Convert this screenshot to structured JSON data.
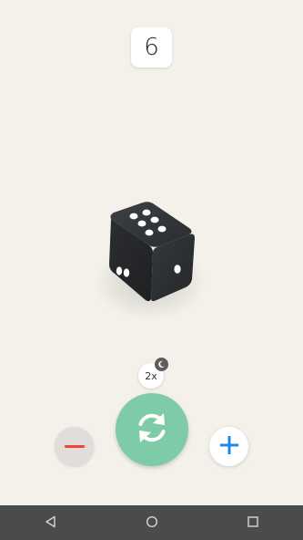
{
  "result": {
    "value": "6"
  },
  "dice": {
    "top_face": 6,
    "body_color": "#2e3033",
    "pip_color": "#ffffff"
  },
  "controls": {
    "multiplier_label": "2x",
    "roll_color": "#7ecba8",
    "minus_color": "#f04438",
    "plus_color": "#1e88e5",
    "icons": {
      "roll": "refresh-icon",
      "minus": "minus-icon",
      "plus": "plus-icon",
      "timer": "clock-icon"
    }
  },
  "navbar": {
    "items": [
      "back",
      "home",
      "recents"
    ]
  }
}
